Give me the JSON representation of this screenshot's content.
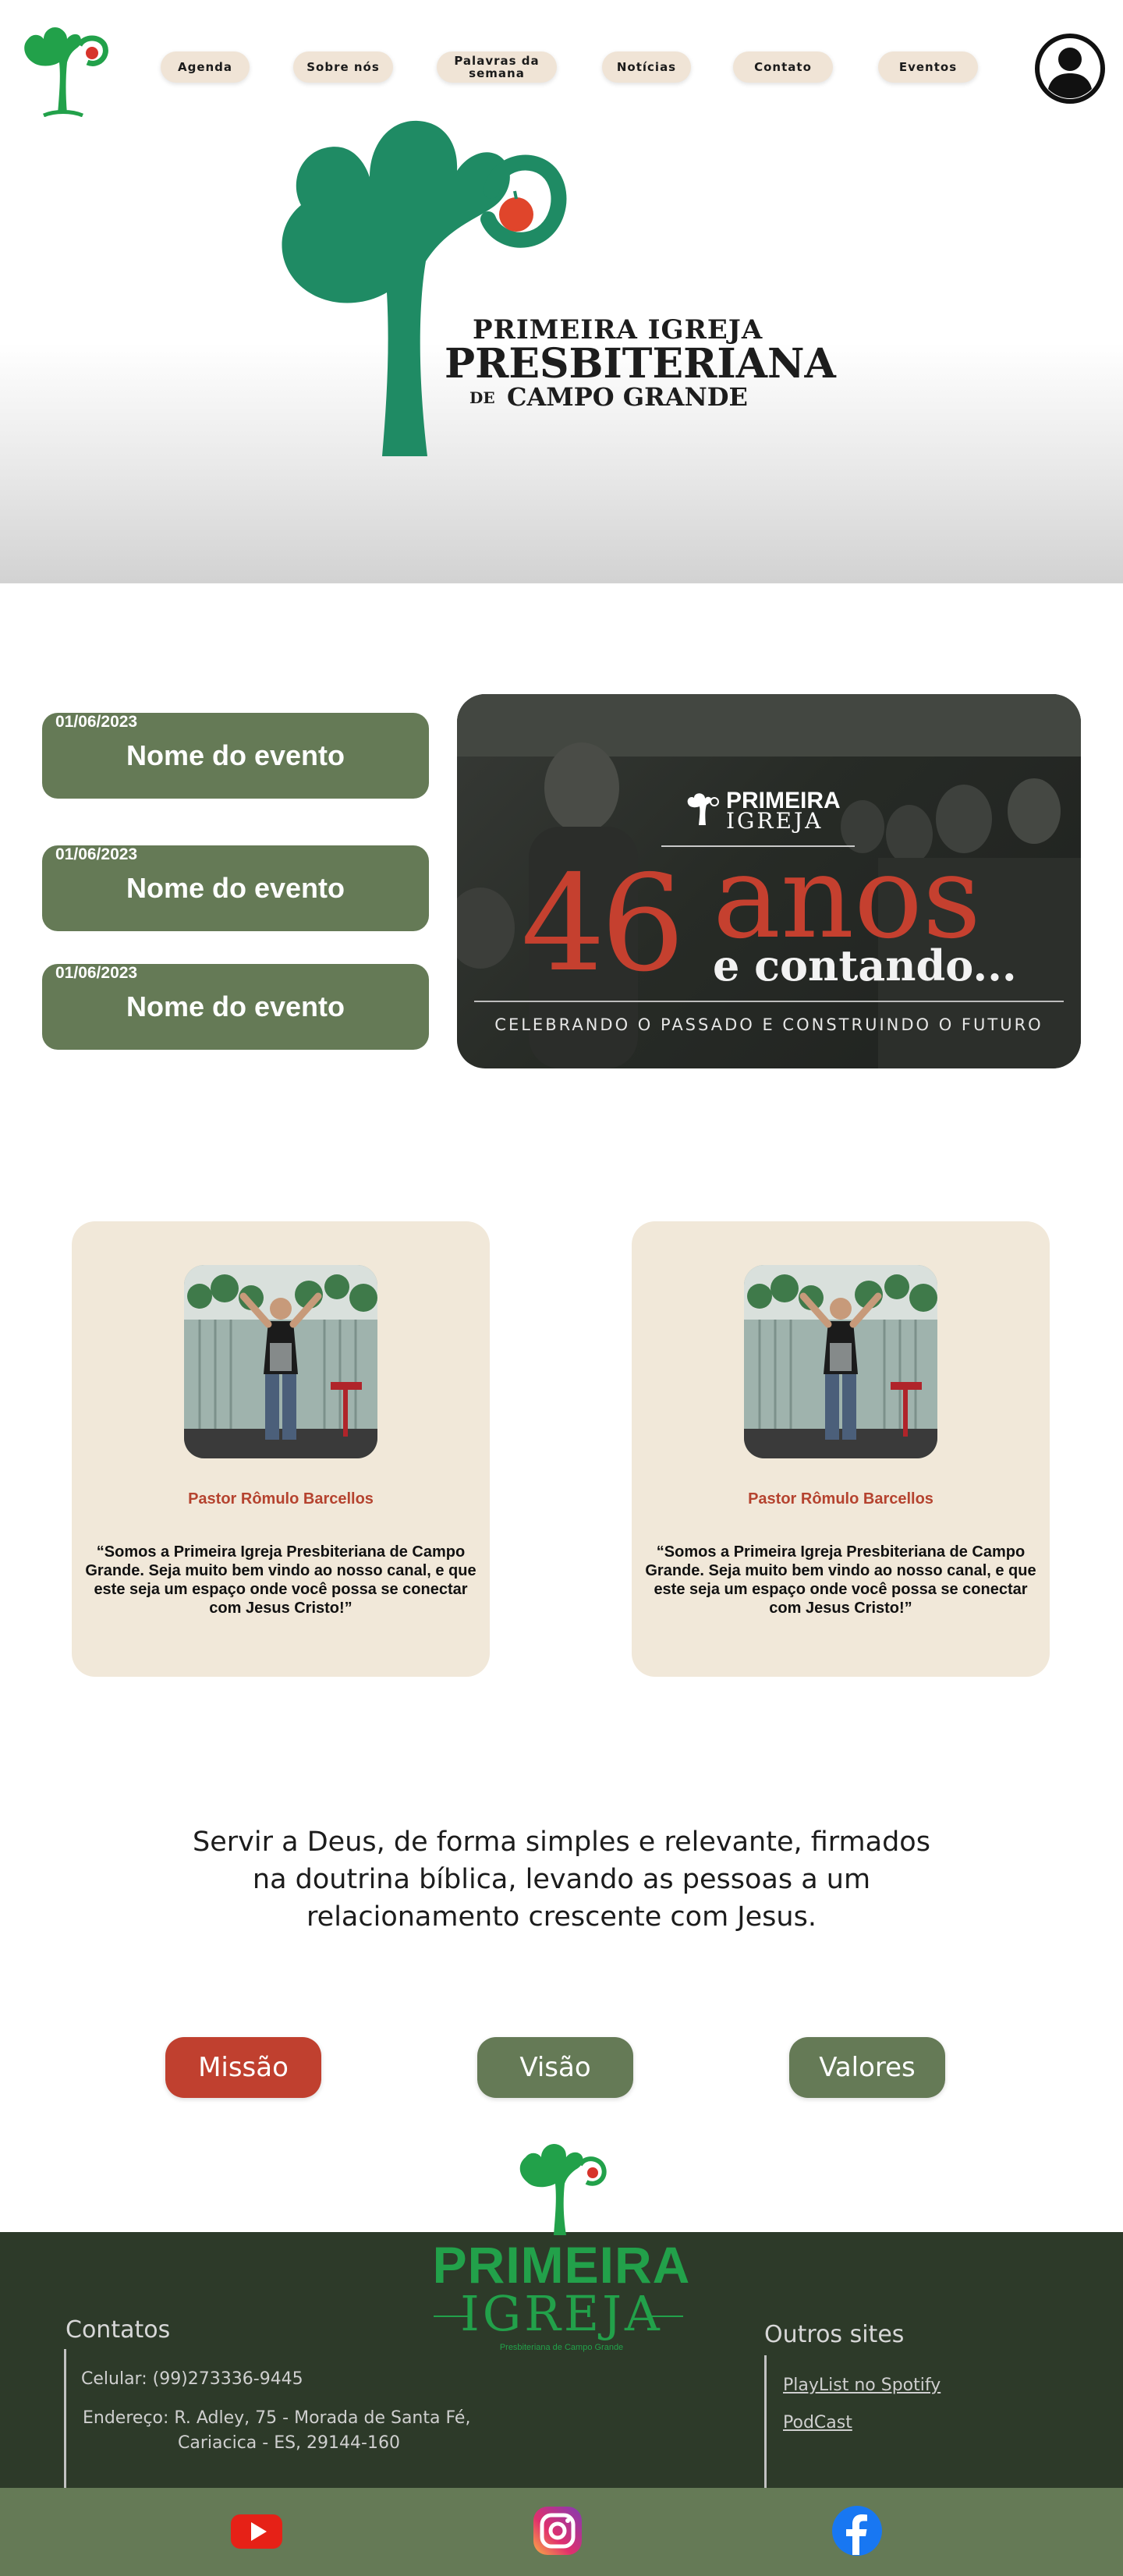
{
  "nav": {
    "items": [
      {
        "label": "Agenda"
      },
      {
        "label": "Sobre nós"
      },
      {
        "label": "Palavras da semana"
      },
      {
        "label": "Notícias"
      },
      {
        "label": "Contato"
      },
      {
        "label": "Eventos"
      }
    ],
    "user_icon": "user-circle-icon"
  },
  "hero": {
    "logo_icon": "tree-logo-icon",
    "brand_line1": "PRIMEIRA IGREJA",
    "brand_line2": "PRESBITERIANA",
    "brand_line3_prefix": "DE",
    "brand_line3": "CAMPO GRANDE"
  },
  "events": [
    {
      "date": "01/06/2023",
      "name": "Nome do evento"
    },
    {
      "date": "01/06/2023",
      "name": "Nome do evento"
    },
    {
      "date": "01/06/2023",
      "name": "Nome do evento"
    }
  ],
  "banner": {
    "brand1": "PRIMEIRA",
    "brand2": "IGREJA",
    "number": "46",
    "word": "anos",
    "tagline": "e contando...",
    "subtitle": "CELEBRANDO O PASSADO E CONSTRUINDO O FUTURO"
  },
  "pastors": [
    {
      "name": "Pastor Rômulo Barcellos",
      "quote": "“Somos a Primeira Igreja Presbiteriana de Campo Grande. Seja muito bem vindo ao nosso canal, e que este seja um espaço onde você possa se conectar com Jesus Cristo!”"
    },
    {
      "name": "Pastor Rômulo Barcellos",
      "quote": "“Somos a Primeira Igreja Presbiteriana de Campo Grande. Seja muito bem vindo ao nosso canal, e que este seja um espaço onde você possa se conectar com Jesus Cristo!”"
    }
  ],
  "mission": {
    "text": "Servir a Deus, de forma simples e relevante, firmados na doutrina bíblica, levando as pessoas a um relacionamento crescente com Jesus."
  },
  "mvv": {
    "missao": "Missão",
    "visao": "Visão",
    "valores": "Valores"
  },
  "footer": {
    "brand1": "PRIMEIRA",
    "brand2": "IGREJA",
    "brand3": "Presbiteriana de Campo Grande",
    "contacts_title": "Contatos",
    "phone": "Celular: (99)273336-9445",
    "address_line1": "Endereço: R. Adley, 75 - Morada de Santa Fé,",
    "address_line2": "Cariacica - ES, 29144-160",
    "other_sites_title": "Outros sites",
    "links": [
      "PlayList no Spotify",
      "PodCast"
    ],
    "social_icons": [
      "youtube-icon",
      "instagram-icon",
      "facebook-icon"
    ]
  },
  "colors": {
    "brand_green": "#22a14a",
    "olive": "#657a56",
    "red": "#c0402f",
    "cream": "#f1e8d9",
    "footer_dark": "#2d3a29"
  }
}
